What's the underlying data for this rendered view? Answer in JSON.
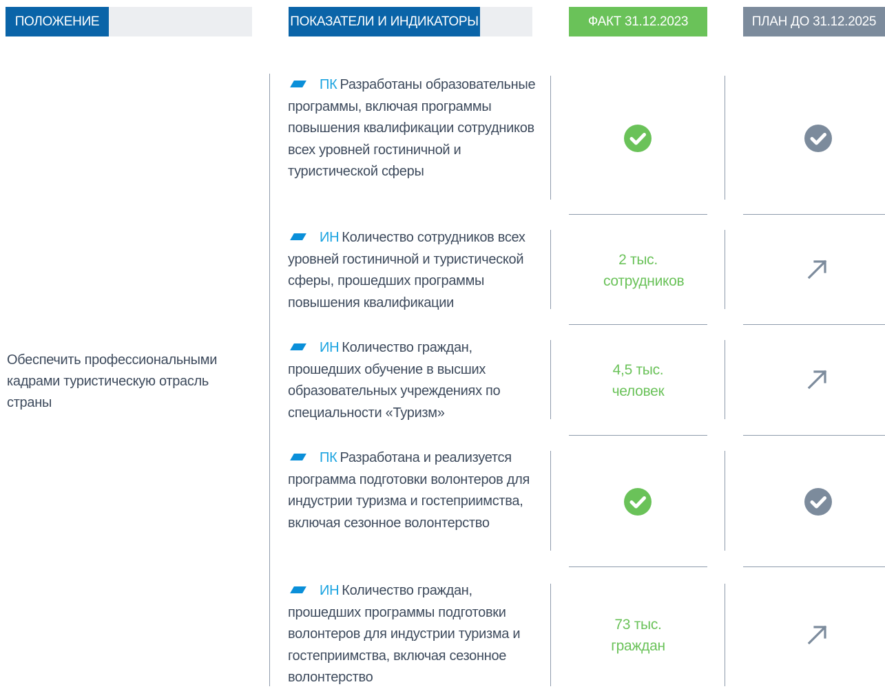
{
  "headers": {
    "position": "ПОЛОЖЕНИЕ",
    "indicators": "ПОКАЗАТЕЛИ И ИНДИКАТОРЫ",
    "fact": "ФАКТ 31.12.2023",
    "plan": "ПЛАН ДО 31.12.2025"
  },
  "position_text": "Обеспечить профессиональными кадрами туристическую отрасль страны",
  "rows": [
    {
      "code": "ПК",
      "text": "Разработаны образовательные программы, включая программы повышения квалификации сотрудников всех уровней гостиничной и туристической сферы",
      "fact": "",
      "fact_icon": "check-circle-icon",
      "plan_icon": "check-circle-icon"
    },
    {
      "code": "ИН",
      "text": "Количество сотрудников всех уровней гостиничной и туристической сферы, прошедших программы повышения квалификации",
      "fact": "2 тыс. сотрудников",
      "fact_icon": "",
      "plan_icon": "arrow-up-right-icon"
    },
    {
      "code": "ИН",
      "text": "Количество граждан, прошедших обучение в высших образовательных учреждениях по специальности «Туризм»",
      "fact": "4,5 тыс. человек",
      "fact_icon": "",
      "plan_icon": "arrow-up-right-icon"
    },
    {
      "code": "ПК",
      "text": "Разработана и реализуется программа подготовки волонтеров для индустрии туризма и гостеприимства, включая сезонное волонтерство",
      "fact": "",
      "fact_icon": "check-circle-icon",
      "plan_icon": "check-circle-icon"
    },
    {
      "code": "ИН",
      "text": "Количество граждан, прошедших программы подготовки волонтеров для индустрии туризма и гостеприимства, включая сезонное волонтерство",
      "fact": "73 тыс. граждан",
      "fact_icon": "",
      "plan_icon": "arrow-up-right-icon"
    }
  ],
  "colors": {
    "header_blue": "#0a64a8",
    "fact_green": "#6ac259",
    "plan_gray": "#7c8b9c",
    "code_blue": "#1aa3e0"
  }
}
